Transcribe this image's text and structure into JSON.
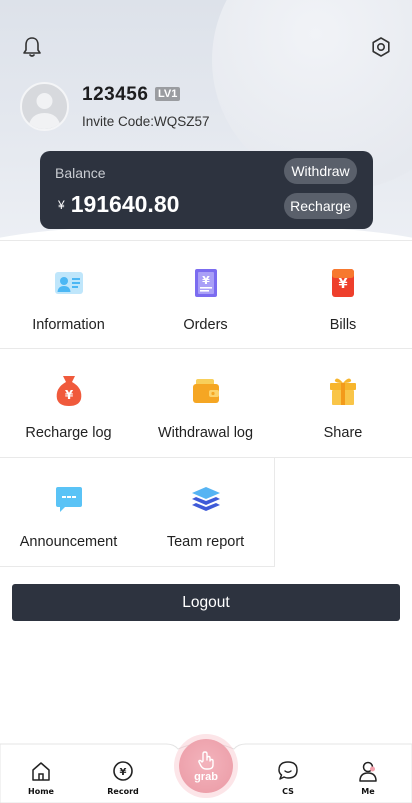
{
  "header": {
    "username": "123456",
    "level": "LV1",
    "invite_code": "Invite Code:WQSZ57"
  },
  "balance": {
    "label": "Balance",
    "currency": "¥",
    "amount": "191640.80",
    "withdraw_label": "Withdraw",
    "recharge_label": "Recharge"
  },
  "menu": [
    {
      "label": "Information",
      "icon": "id-card-icon"
    },
    {
      "label": "Orders",
      "icon": "order-yen-icon"
    },
    {
      "label": "Bills",
      "icon": "bill-yen-icon"
    },
    {
      "label": "Recharge log",
      "icon": "money-bag-icon"
    },
    {
      "label": "Withdrawal log",
      "icon": "wallet-icon"
    },
    {
      "label": "Share",
      "icon": "gift-icon"
    },
    {
      "label": "Announcement",
      "icon": "message-icon"
    },
    {
      "label": "Team report",
      "icon": "layers-icon"
    }
  ],
  "logout_label": "Logout",
  "nav": {
    "home": "Home",
    "record": "Record",
    "grab": "grab",
    "cs": "CS",
    "me": "Me"
  },
  "colors": {
    "dark": "#2d333f",
    "pill": "#5a606b",
    "grab": "#eea4ae",
    "icon_blue": "#4cb7f4",
    "icon_orange": "#f5a623",
    "icon_red": "#f05a3c",
    "icon_purple": "#7b6cf0"
  }
}
